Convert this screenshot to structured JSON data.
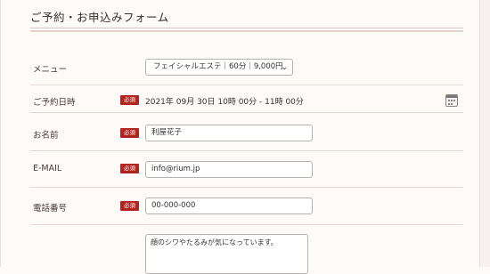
{
  "form": {
    "title": "ご予約・お申込みフォーム",
    "required_badge": "必須"
  },
  "menu": {
    "label": "メニュー",
    "selected": "フェイシャルエステ｜60分｜9,000円"
  },
  "reservation": {
    "label": "ご予約日時",
    "value": "2021年 09月 30日 10時 00分 - 11時 00分"
  },
  "name": {
    "label": "お名前",
    "value": "利屋花子"
  },
  "email": {
    "label": "E-MAIL",
    "value": "info@rium.jp"
  },
  "phone": {
    "label": "電話番号",
    "value": "00-000-000"
  },
  "message": {
    "value": "顔のシワやたるみが気になっています。"
  }
}
